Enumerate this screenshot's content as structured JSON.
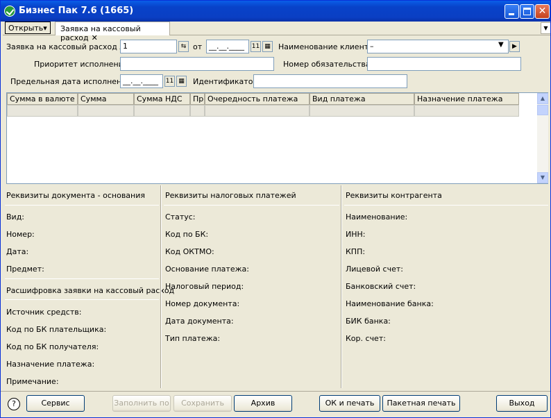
{
  "window": {
    "title": "Бизнес Пак 7.6 (1665)"
  },
  "tabbar": {
    "open_label": "Открыть▾",
    "tab_label": "Заявка на кассовый расход",
    "tab_close": "✕",
    "overflow": "▼"
  },
  "form": {
    "number_label": "Заявка на кассовый расход №",
    "number_value": "1",
    "from_label": "от",
    "date_value": "__.__.____",
    "client_label": "Наименование клиента",
    "client_value": "–",
    "priority_label": "Приоритет исполнения",
    "priority_value": "",
    "obligation_label": "Номер обязательства",
    "obligation_value": "",
    "deadline_label": "Предельная дата исполнения",
    "deadline_value": "__.__.____",
    "id_label": "Идентификатор",
    "id_value": ""
  },
  "table": {
    "columns": [
      "Сумма в валюте",
      "Сумма",
      "Сумма НДС",
      "Пр",
      "Очередность платежа",
      "Вид платежа",
      "Назначение платежа"
    ]
  },
  "left": {
    "header": "Реквизиты документа - основания",
    "fields": [
      "Вид:",
      "Номер:",
      "Дата:",
      "Предмет:"
    ],
    "header2": "Расшифровка заявки на кассовый расход",
    "fields2": [
      "Источник средств:",
      "Код по БК плательщика:",
      "Код по БК получателя:",
      "Назначение платежа:",
      "Примечание:"
    ]
  },
  "middle": {
    "header": "Реквизиты налоговых платежей",
    "fields": [
      "Статус:",
      "Код по БК:",
      "Код ОКТМО:",
      "Основание платежа:",
      "Налоговый период:",
      "Номер документа:",
      "Дата документа:",
      "Тип платежа:"
    ]
  },
  "right": {
    "header": "Реквизиты контрагента",
    "fields": [
      "Наименование:",
      "ИНН:",
      "КПП:",
      "Лицевой счет:",
      "Банковский счет:",
      "Наименование банка:",
      "БИК банка:",
      "Кор. счет:"
    ]
  },
  "buttons": {
    "help": "?",
    "service": "Сервис",
    "fill": "Заполнить по",
    "save": "Сохранить",
    "archive": "Архив",
    "ok_print": "ОК и печать",
    "batch_print": "Пакетная печать",
    "exit": "Выход"
  }
}
